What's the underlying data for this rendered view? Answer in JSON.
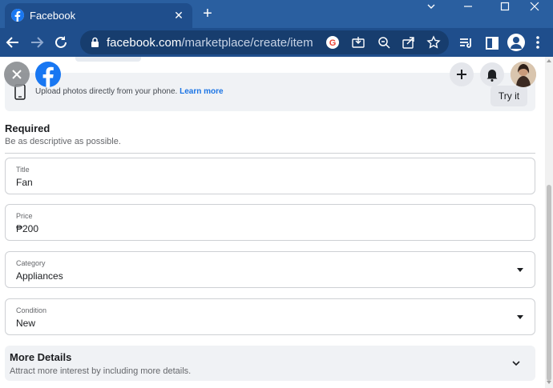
{
  "browser": {
    "tab": {
      "title": "Facebook",
      "close": "✕"
    },
    "new_tab": "+",
    "window_controls": {
      "minimize": "–",
      "maximize": "□",
      "close": "✕"
    },
    "url": {
      "domain": "facebook.com",
      "path": "/marketplace/create/item"
    }
  },
  "page": {
    "banner": {
      "text": "Upload photos directly from your phone.",
      "link": "Learn more",
      "button": "Try it"
    },
    "header_icons": [
      "close-icon",
      "facebook-logo",
      "plus-icon",
      "bell-icon",
      "profile-avatar"
    ],
    "required": {
      "title": "Required",
      "subtitle": "Be as descriptive as possible."
    },
    "fields": [
      {
        "label": "Title",
        "value": "Fan",
        "type": "text"
      },
      {
        "label": "Price",
        "value": "₱200",
        "type": "text"
      },
      {
        "label": "Category",
        "value": "Appliances",
        "type": "select"
      },
      {
        "label": "Condition",
        "value": "New",
        "type": "select"
      }
    ],
    "more_details": {
      "title": "More Details",
      "subtitle": "Attract more interest by including more details."
    }
  },
  "colors": {
    "titlebar": "#2a5fa0",
    "toolbar": "#1f4e8c",
    "facebook_blue": "#1877f2",
    "link_blue": "#1b74e4"
  }
}
